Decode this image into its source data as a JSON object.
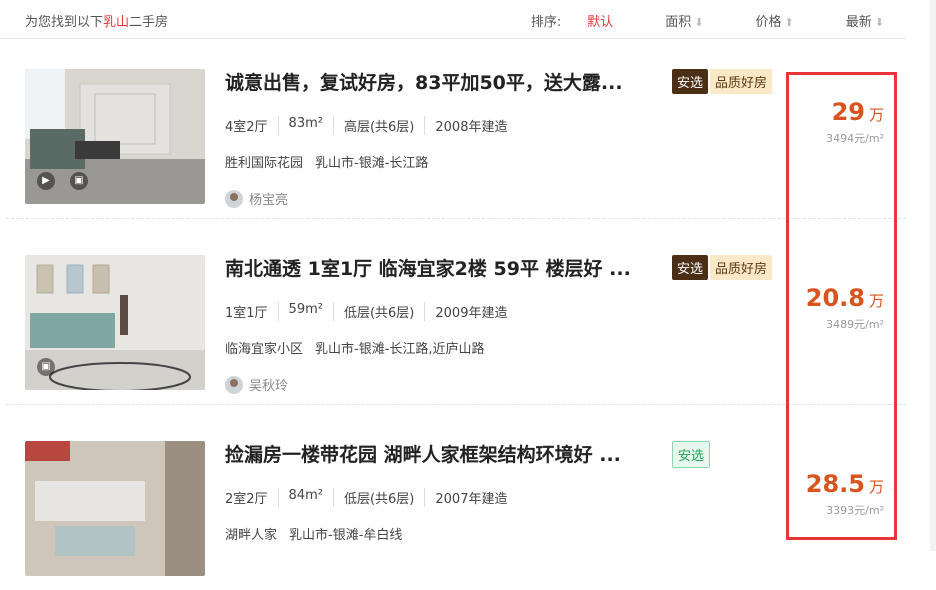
{
  "header": {
    "found_prefix": "为您找到以下",
    "city": "乳山",
    "found_suffix": "二手房",
    "sort_label": "排序:",
    "sort_options": [
      "默认",
      "面积",
      "价格",
      "最新"
    ]
  },
  "listings": [
    {
      "title": "诚意出售，复试好房，83平加50平，送大露...",
      "tag_anxuan": "安选",
      "tag_quality": "品质好房",
      "attrs": [
        "4室2厅",
        "83m²",
        "高层(共6层)",
        "2008年建造"
      ],
      "community": "胜利国际花园",
      "district": "乳山市-银滩-长江路",
      "agent": "杨宝亮",
      "price": "29",
      "price_unit": "万",
      "unit_price": "3494元/m²"
    },
    {
      "title": "南北通透 1室1厅 临海宜家2楼 59平 楼层好 ...",
      "tag_anxuan": "安选",
      "tag_quality": "品质好房",
      "attrs": [
        "1室1厅",
        "59m²",
        "低层(共6层)",
        "2009年建造"
      ],
      "community": "临海宜家小区",
      "district": "乳山市-银滩-长江路,近庐山路",
      "agent": "吴秋玲",
      "price": "20.8",
      "price_unit": "万",
      "unit_price": "3489元/m²"
    },
    {
      "title": "捡漏房一楼带花园 湖畔人家框架结构环境好 ...",
      "tag_anxuan": "安选",
      "attrs": [
        "2室2厅",
        "84m²",
        "低层(共6层)",
        "2007年建造"
      ],
      "community": "湖畔人家",
      "district": "乳山市-银滩-牟白线",
      "price": "28.5",
      "price_unit": "万",
      "unit_price": "3393元/m²"
    }
  ],
  "colors": {
    "accent": "#e4393c",
    "price": "#d9531e",
    "highlight_box": "#e8343a"
  }
}
